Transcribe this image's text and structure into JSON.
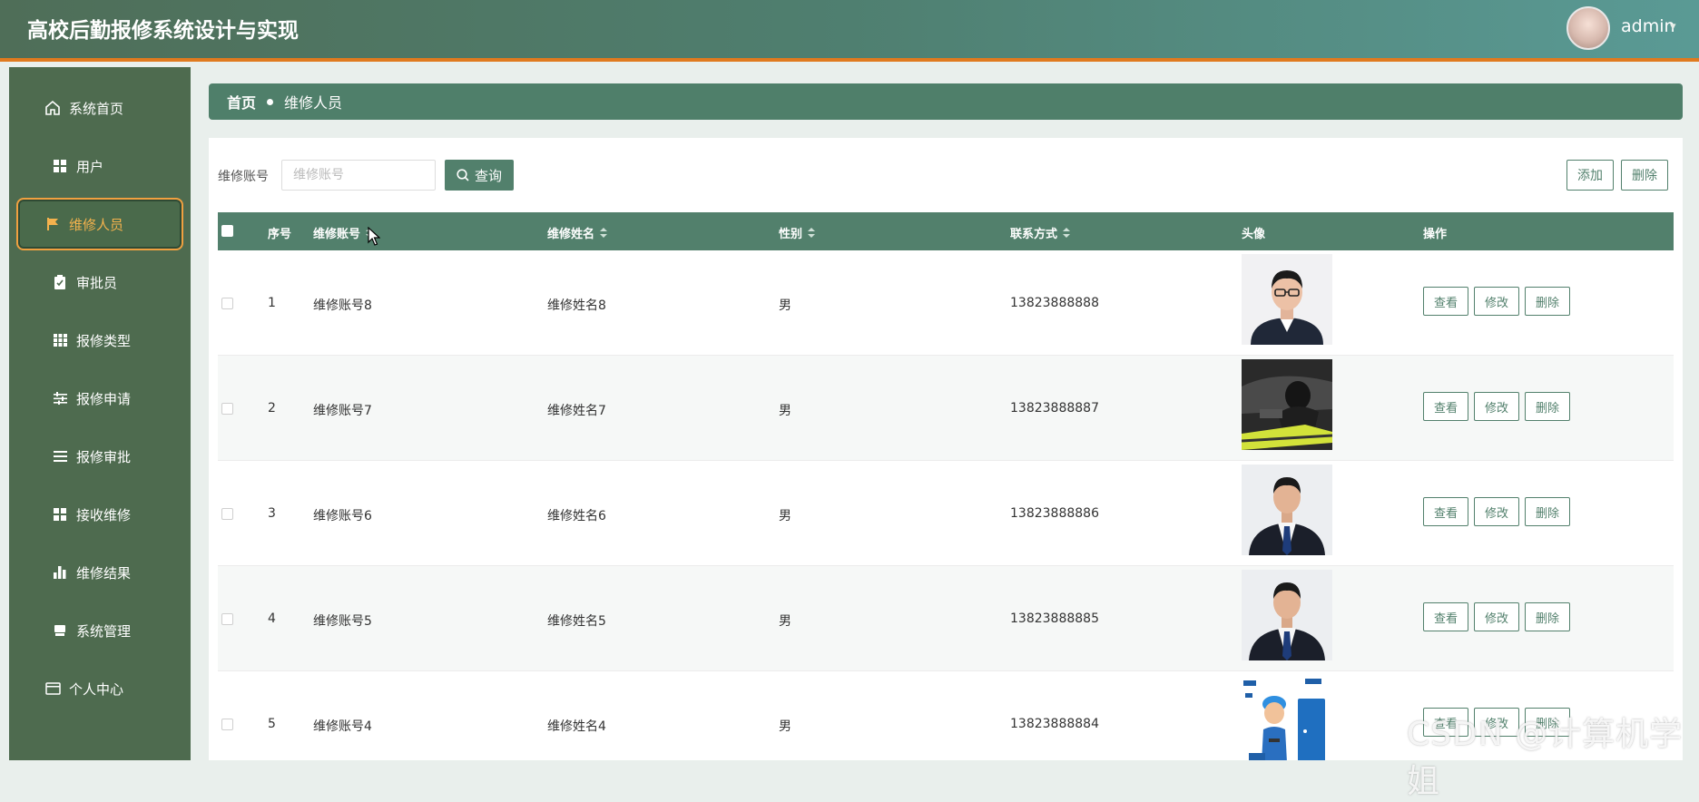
{
  "app": {
    "title": "高校后勤报修系统设计与实现"
  },
  "user": {
    "name": "admin",
    "caret": "▾"
  },
  "sidebar": {
    "items": [
      {
        "label": "系统首页",
        "icon": "home-icon"
      },
      {
        "label": "用户",
        "icon": "grid-icon"
      },
      {
        "label": "维修人员",
        "icon": "flag-icon",
        "active": true
      },
      {
        "label": "审批员",
        "icon": "clipboard-icon"
      },
      {
        "label": "报修类型",
        "icon": "table-icon"
      },
      {
        "label": "报修申请",
        "icon": "sliders-icon"
      },
      {
        "label": "报修审批",
        "icon": "list-icon"
      },
      {
        "label": "接收维修",
        "icon": "grid-icon"
      },
      {
        "label": "维修结果",
        "icon": "bar-chart-icon"
      },
      {
        "label": "系统管理",
        "icon": "printer-icon"
      },
      {
        "label": "个人中心",
        "icon": "id-card-icon"
      }
    ]
  },
  "breadcrumb": {
    "home": "首页",
    "current": "维修人员"
  },
  "search": {
    "label": "维修账号",
    "placeholder": "维修账号",
    "value": "",
    "button_label": "查询"
  },
  "toolbar": {
    "add_label": "添加",
    "delete_label": "删除"
  },
  "table": {
    "columns": [
      "序号",
      "维修账号",
      "维修姓名",
      "性别",
      "联系方式",
      "头像",
      "操作"
    ],
    "rows": [
      {
        "index": "1",
        "account": "维修账号8",
        "name": "维修姓名8",
        "gender": "男",
        "phone": "13823888888",
        "photo": "portrait-glasses"
      },
      {
        "index": "2",
        "account": "维修账号7",
        "name": "维修姓名7",
        "gender": "男",
        "phone": "13823888887",
        "photo": "car-repair"
      },
      {
        "index": "3",
        "account": "维修账号6",
        "name": "维修姓名6",
        "gender": "男",
        "phone": "13823888886",
        "photo": "portrait-suit"
      },
      {
        "index": "4",
        "account": "维修账号5",
        "name": "维修姓名5",
        "gender": "男",
        "phone": "13823888885",
        "photo": "portrait-suit"
      },
      {
        "index": "5",
        "account": "维修账号4",
        "name": "维修姓名4",
        "gender": "男",
        "phone": "13823888884",
        "photo": "cartoon-repairman"
      }
    ],
    "row_actions": {
      "view": "查看",
      "edit": "修改",
      "delete": "删除"
    }
  },
  "watermark": "CSDN @计算机学姐",
  "colors": {
    "accent": "#52806c",
    "sidebar": "#4e6b4f",
    "active": "#f4b24d",
    "header_border": "#e07a1f"
  }
}
